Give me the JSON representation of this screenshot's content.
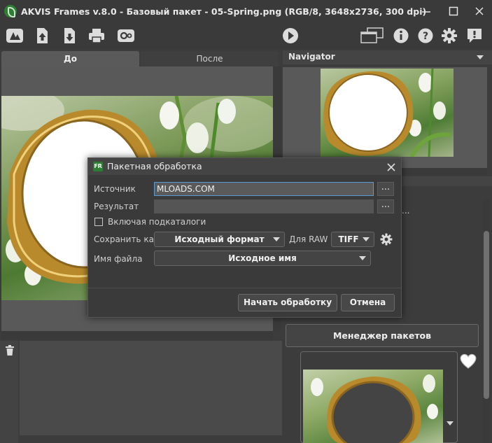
{
  "window": {
    "title": "AKVIS Frames v.8.0 - Базовый пакет - 05-Spring.png (RGB/8, 3648x2736, 300 dpi)",
    "controls": [
      "minimize",
      "maximize",
      "close"
    ]
  },
  "toolbar": {
    "left_icons": [
      "logo-icon",
      "open-icon",
      "save-icon",
      "print-icon",
      "batch-settings-icon"
    ],
    "right_icons": [
      "run-icon",
      "windows-icon",
      "info-icon",
      "help-icon",
      "settings-icon",
      "feedback-icon"
    ]
  },
  "tabs": {
    "before": "До",
    "after": "После"
  },
  "navigator": {
    "title": "Navigator"
  },
  "dialog": {
    "title": "Пакетная обработка",
    "icon_text": "FR",
    "source_label": "Источник",
    "source_value": "MLOADS.COM",
    "result_label": "Результат",
    "result_value": "",
    "browse_label": "...",
    "include_subfolders": "Включая подкаталоги",
    "save_as_label": "Сохранить как",
    "save_as_value": "Исходный формат",
    "raw_label": "Для RAW",
    "raw_value": "TIFF",
    "filename_label": "Имя файла",
    "filename_value": "Исходное имя",
    "start_button": "Начать обработку",
    "cancel_button": "Отмена"
  },
  "side": {
    "partial_text": "...",
    "manager_button": "Менеджер пакетов"
  }
}
